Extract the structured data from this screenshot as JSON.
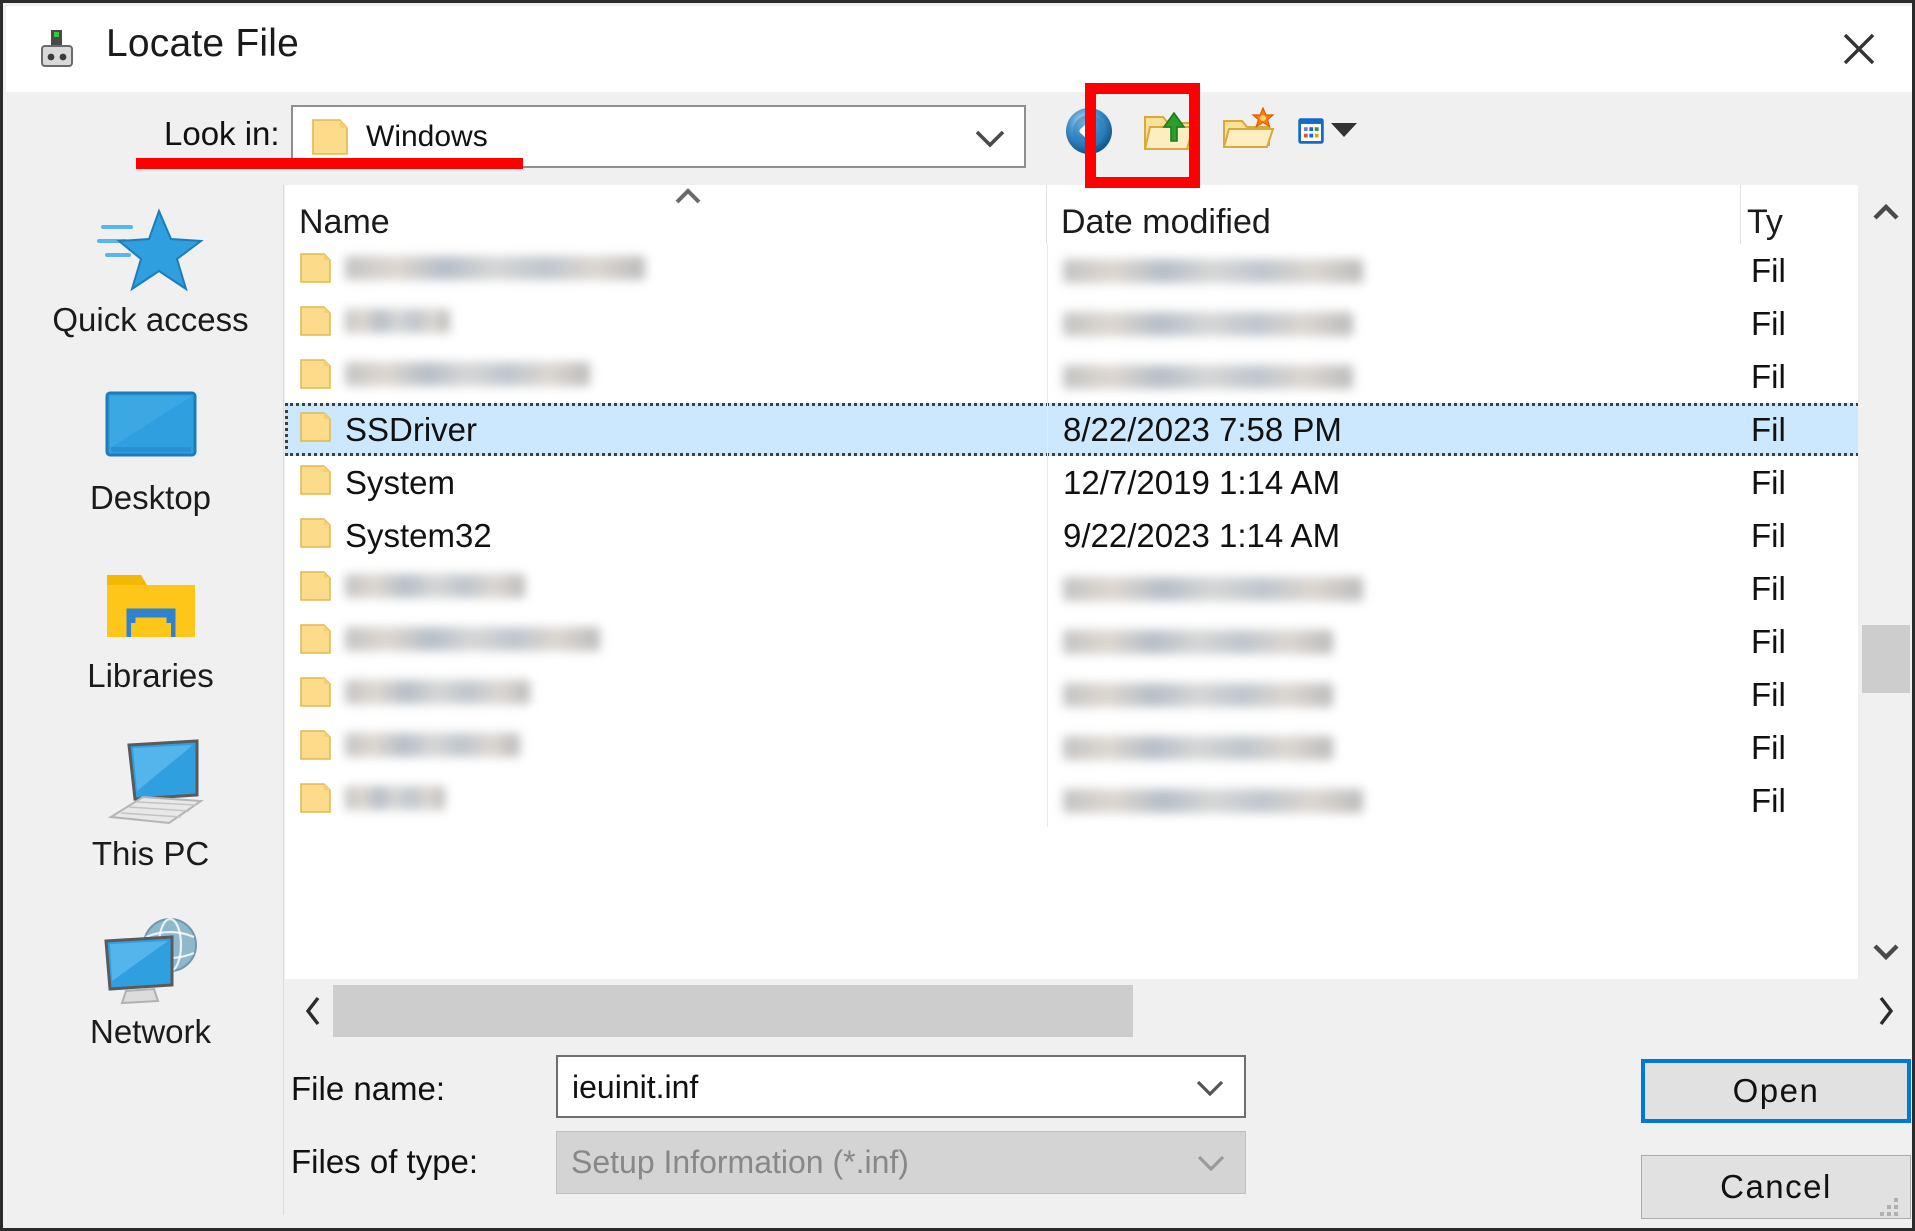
{
  "window": {
    "title": "Locate File",
    "title_icon": "plug-device-icon",
    "close_label": "✕"
  },
  "lookin": {
    "label": "Look in:",
    "value": "Windows",
    "icon": "folder-icon",
    "caret": "chevron-down-icon"
  },
  "toolbar": {
    "buttons": [
      {
        "name": "back-button",
        "icon": "back-navigation-icon",
        "highlighted": false
      },
      {
        "name": "up-one-level-button",
        "icon": "folder-up-arrow-icon",
        "highlighted": true
      },
      {
        "name": "create-new-folder-button",
        "icon": "new-folder-icon",
        "highlighted": false
      },
      {
        "name": "views-button",
        "icon": "views-grid-icon",
        "highlighted": false
      }
    ]
  },
  "annotations": {
    "highlight_box_color": "#ff0000",
    "underline_color": "#ff0000"
  },
  "places": [
    {
      "label": "Quick access",
      "icon": "quick-access-star-icon"
    },
    {
      "label": "Desktop",
      "icon": "desktop-monitor-icon"
    },
    {
      "label": "Libraries",
      "icon": "libraries-folder-icon"
    },
    {
      "label": "This PC",
      "icon": "this-pc-icon"
    },
    {
      "label": "Network",
      "icon": "network-globe-icon"
    }
  ],
  "filelist": {
    "columns": [
      {
        "key": "name",
        "label": "Name",
        "sorted": "asc"
      },
      {
        "key": "date",
        "label": "Date modified",
        "sorted": "none"
      },
      {
        "key": "type",
        "label": "Ty",
        "sorted": "asc"
      }
    ],
    "rows": [
      {
        "name": "",
        "date": "",
        "type": "Fil",
        "blurred": true,
        "name_width": 300,
        "date_width": 300,
        "selected": false
      },
      {
        "name": "",
        "date": "",
        "type": "Fil",
        "blurred": true,
        "name_width": 105,
        "date_width": 290,
        "selected": false
      },
      {
        "name": "",
        "date": "",
        "type": "Fil",
        "blurred": true,
        "name_width": 245,
        "date_width": 290,
        "selected": false
      },
      {
        "name": "SSDriver",
        "date": "8/22/2023 7:58 PM",
        "type": "Fil",
        "blurred": false,
        "selected": true
      },
      {
        "name": "System",
        "date": "12/7/2019 1:14 AM",
        "type": "Fil",
        "blurred": false,
        "selected": false
      },
      {
        "name": "System32",
        "date": "9/22/2023 1:14 AM",
        "type": "Fil",
        "blurred": false,
        "selected": false
      },
      {
        "name": "",
        "date": "",
        "type": "Fil",
        "blurred": true,
        "name_width": 180,
        "date_width": 300,
        "selected": false
      },
      {
        "name": "",
        "date": "",
        "type": "Fil",
        "blurred": true,
        "name_width": 255,
        "date_width": 270,
        "selected": false
      },
      {
        "name": "",
        "date": "",
        "type": "Fil",
        "blurred": true,
        "name_width": 185,
        "date_width": 270,
        "selected": false
      },
      {
        "name": "",
        "date": "",
        "type": "Fil",
        "blurred": true,
        "name_width": 175,
        "date_width": 270,
        "selected": false
      },
      {
        "name": "",
        "date": "",
        "type": "Fil",
        "blurred": true,
        "name_width": 100,
        "date_width": 300,
        "selected": false
      }
    ]
  },
  "scrollbars": {
    "vertical": {
      "up": "chevron-up-icon",
      "down": "chevron-down-icon"
    },
    "horizontal": {
      "left": "chevron-left-icon",
      "right": "chevron-right-icon"
    }
  },
  "form": {
    "filename_label": "File name:",
    "filename_value": "ieuinit.inf",
    "filetype_label": "Files of type:",
    "filetype_value": "Setup Information (*.inf)",
    "filetype_disabled": true
  },
  "buttons": {
    "open": "Open",
    "cancel": "Cancel"
  },
  "colors": {
    "selection_bg": "#cce8ff",
    "focus_blue": "#0078d7",
    "dialog_bg": "#f0f0f0",
    "annotation_red": "#ff0000"
  }
}
